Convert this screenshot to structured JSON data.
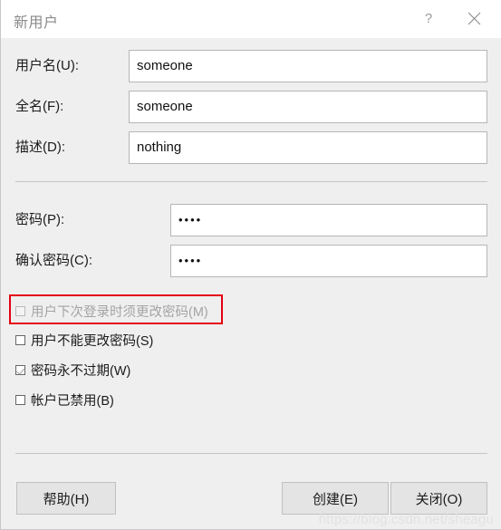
{
  "window": {
    "title": "新用户",
    "help_icon": "question-mark-icon",
    "close_icon": "close-icon"
  },
  "form": {
    "fields": [
      {
        "label": "用户名(U):",
        "value": "someone",
        "type": "text"
      },
      {
        "label": "全名(F):",
        "value": "someone",
        "type": "text"
      },
      {
        "label": "描述(D):",
        "value": "nothing",
        "type": "text"
      },
      {
        "label": "密码(P):",
        "value": "••••",
        "type": "password"
      },
      {
        "label": "确认密码(C):",
        "value": "••••",
        "type": "password"
      }
    ]
  },
  "options": [
    {
      "label": "用户下次登录时须更改密码(M)",
      "checked": false,
      "disabled": true
    },
    {
      "label": "用户不能更改密码(S)",
      "checked": false,
      "disabled": false
    },
    {
      "label": "密码永不过期(W)",
      "checked": true,
      "disabled": false
    },
    {
      "label": "帐户已禁用(B)",
      "checked": false,
      "disabled": false
    }
  ],
  "annotation": {
    "color": "#e60012",
    "target": "用户下次登录时须更改密码(M)"
  },
  "buttons": {
    "help": "帮助(H)",
    "create": "创建(E)",
    "close": "关闭(O)"
  },
  "watermark": "https://blog.csdn.net/sheagu"
}
